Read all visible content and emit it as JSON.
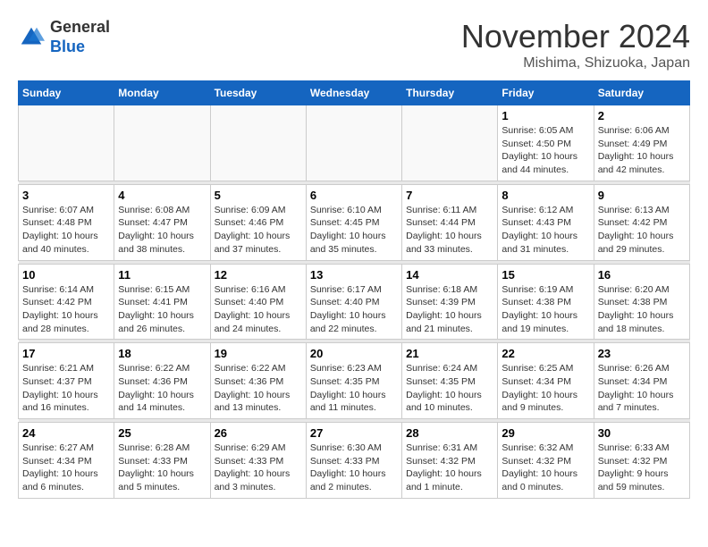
{
  "header": {
    "logo_general": "General",
    "logo_blue": "Blue",
    "month_title": "November 2024",
    "location": "Mishima, Shizuoka, Japan"
  },
  "weekdays": [
    "Sunday",
    "Monday",
    "Tuesday",
    "Wednesday",
    "Thursday",
    "Friday",
    "Saturday"
  ],
  "weeks": [
    [
      {
        "day": "",
        "info": ""
      },
      {
        "day": "",
        "info": ""
      },
      {
        "day": "",
        "info": ""
      },
      {
        "day": "",
        "info": ""
      },
      {
        "day": "",
        "info": ""
      },
      {
        "day": "1",
        "info": "Sunrise: 6:05 AM\nSunset: 4:50 PM\nDaylight: 10 hours and 44 minutes."
      },
      {
        "day": "2",
        "info": "Sunrise: 6:06 AM\nSunset: 4:49 PM\nDaylight: 10 hours and 42 minutes."
      }
    ],
    [
      {
        "day": "3",
        "info": "Sunrise: 6:07 AM\nSunset: 4:48 PM\nDaylight: 10 hours and 40 minutes."
      },
      {
        "day": "4",
        "info": "Sunrise: 6:08 AM\nSunset: 4:47 PM\nDaylight: 10 hours and 38 minutes."
      },
      {
        "day": "5",
        "info": "Sunrise: 6:09 AM\nSunset: 4:46 PM\nDaylight: 10 hours and 37 minutes."
      },
      {
        "day": "6",
        "info": "Sunrise: 6:10 AM\nSunset: 4:45 PM\nDaylight: 10 hours and 35 minutes."
      },
      {
        "day": "7",
        "info": "Sunrise: 6:11 AM\nSunset: 4:44 PM\nDaylight: 10 hours and 33 minutes."
      },
      {
        "day": "8",
        "info": "Sunrise: 6:12 AM\nSunset: 4:43 PM\nDaylight: 10 hours and 31 minutes."
      },
      {
        "day": "9",
        "info": "Sunrise: 6:13 AM\nSunset: 4:42 PM\nDaylight: 10 hours and 29 minutes."
      }
    ],
    [
      {
        "day": "10",
        "info": "Sunrise: 6:14 AM\nSunset: 4:42 PM\nDaylight: 10 hours and 28 minutes."
      },
      {
        "day": "11",
        "info": "Sunrise: 6:15 AM\nSunset: 4:41 PM\nDaylight: 10 hours and 26 minutes."
      },
      {
        "day": "12",
        "info": "Sunrise: 6:16 AM\nSunset: 4:40 PM\nDaylight: 10 hours and 24 minutes."
      },
      {
        "day": "13",
        "info": "Sunrise: 6:17 AM\nSunset: 4:40 PM\nDaylight: 10 hours and 22 minutes."
      },
      {
        "day": "14",
        "info": "Sunrise: 6:18 AM\nSunset: 4:39 PM\nDaylight: 10 hours and 21 minutes."
      },
      {
        "day": "15",
        "info": "Sunrise: 6:19 AM\nSunset: 4:38 PM\nDaylight: 10 hours and 19 minutes."
      },
      {
        "day": "16",
        "info": "Sunrise: 6:20 AM\nSunset: 4:38 PM\nDaylight: 10 hours and 18 minutes."
      }
    ],
    [
      {
        "day": "17",
        "info": "Sunrise: 6:21 AM\nSunset: 4:37 PM\nDaylight: 10 hours and 16 minutes."
      },
      {
        "day": "18",
        "info": "Sunrise: 6:22 AM\nSunset: 4:36 PM\nDaylight: 10 hours and 14 minutes."
      },
      {
        "day": "19",
        "info": "Sunrise: 6:22 AM\nSunset: 4:36 PM\nDaylight: 10 hours and 13 minutes."
      },
      {
        "day": "20",
        "info": "Sunrise: 6:23 AM\nSunset: 4:35 PM\nDaylight: 10 hours and 11 minutes."
      },
      {
        "day": "21",
        "info": "Sunrise: 6:24 AM\nSunset: 4:35 PM\nDaylight: 10 hours and 10 minutes."
      },
      {
        "day": "22",
        "info": "Sunrise: 6:25 AM\nSunset: 4:34 PM\nDaylight: 10 hours and 9 minutes."
      },
      {
        "day": "23",
        "info": "Sunrise: 6:26 AM\nSunset: 4:34 PM\nDaylight: 10 hours and 7 minutes."
      }
    ],
    [
      {
        "day": "24",
        "info": "Sunrise: 6:27 AM\nSunset: 4:34 PM\nDaylight: 10 hours and 6 minutes."
      },
      {
        "day": "25",
        "info": "Sunrise: 6:28 AM\nSunset: 4:33 PM\nDaylight: 10 hours and 5 minutes."
      },
      {
        "day": "26",
        "info": "Sunrise: 6:29 AM\nSunset: 4:33 PM\nDaylight: 10 hours and 3 minutes."
      },
      {
        "day": "27",
        "info": "Sunrise: 6:30 AM\nSunset: 4:33 PM\nDaylight: 10 hours and 2 minutes."
      },
      {
        "day": "28",
        "info": "Sunrise: 6:31 AM\nSunset: 4:32 PM\nDaylight: 10 hours and 1 minute."
      },
      {
        "day": "29",
        "info": "Sunrise: 6:32 AM\nSunset: 4:32 PM\nDaylight: 10 hours and 0 minutes."
      },
      {
        "day": "30",
        "info": "Sunrise: 6:33 AM\nSunset: 4:32 PM\nDaylight: 9 hours and 59 minutes."
      }
    ]
  ]
}
